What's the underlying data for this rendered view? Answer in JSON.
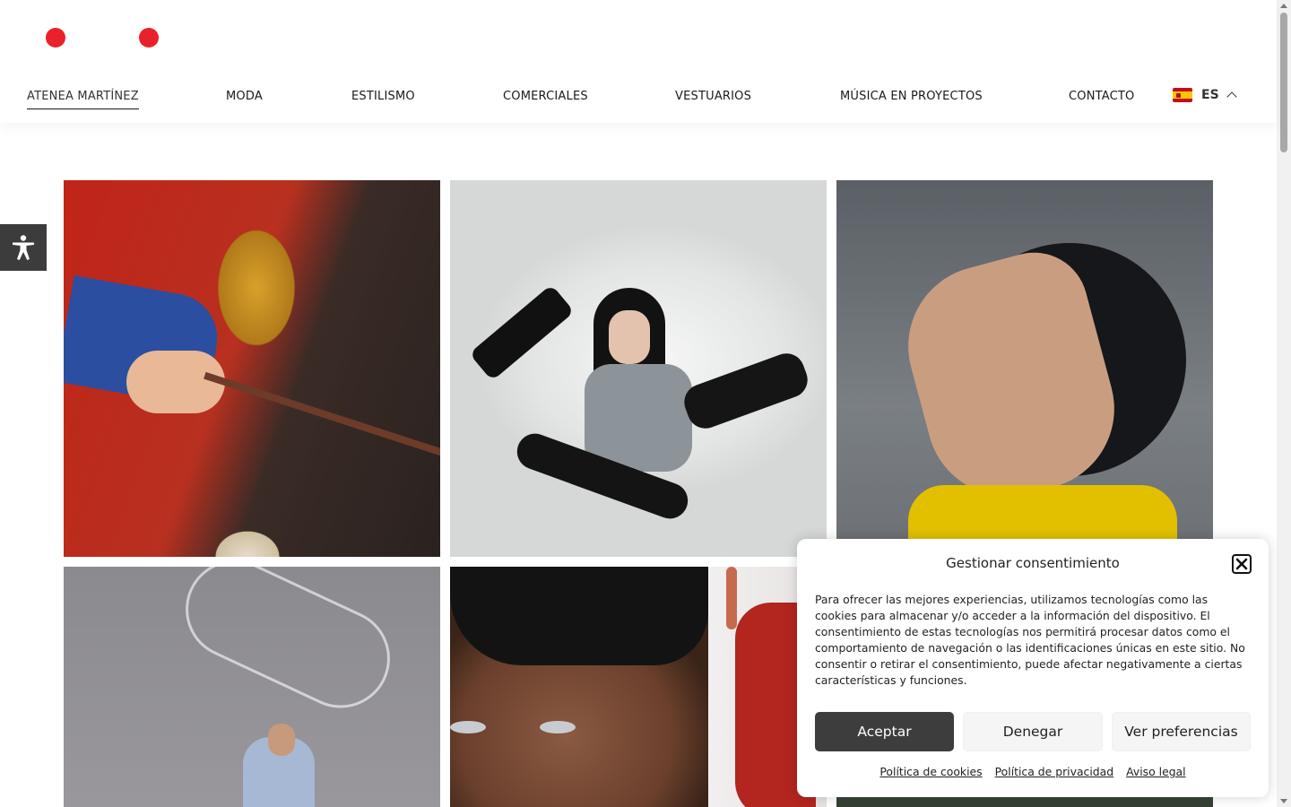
{
  "brand": {
    "accent_color": "#e8222a"
  },
  "nav": {
    "items": [
      {
        "label": "ATENEA MARTÍNEZ"
      },
      {
        "label": "MODA"
      },
      {
        "label": "ESTILISMO"
      },
      {
        "label": "COMERCIALES"
      },
      {
        "label": "VESTUARIOS"
      },
      {
        "label": "MÚSICA EN PROYECTOS"
      },
      {
        "label": "CONTACTO"
      }
    ],
    "active_index": 0,
    "language": {
      "code": "ES",
      "flag_icon": "spain-flag-icon"
    }
  },
  "accessibility": {
    "icon": "accessibility-icon"
  },
  "gallery": {
    "images": [
      {
        "subject": "rider-red-jacket-gold-chain"
      },
      {
        "subject": "woman-black-lace-boots"
      },
      {
        "subject": "man-head-tilted-tongue"
      },
      {
        "subject": "man-bubble-sky"
      },
      {
        "subject": "eyes-closeup-black-hair"
      },
      {
        "subject": "figure-red-outfit"
      },
      {
        "subject": "landscape-partial"
      }
    ]
  },
  "consent": {
    "title": "Gestionar consentimiento",
    "text": "Para ofrecer las mejores experiencias, utilizamos tecnologías como las cookies para almacenar y/o acceder a la información del dispositivo. El consentimiento de estas tecnologías nos permitirá procesar datos como el comportamiento de navegación o las identificaciones únicas en este sitio. No consentir o retirar el consentimiento, puede afectar negativamente a ciertas características y funciones.",
    "accept_label": "Aceptar",
    "deny_label": "Denegar",
    "prefs_label": "Ver preferencias",
    "links": [
      "Política de cookies",
      "Política de privacidad",
      "Aviso legal"
    ]
  }
}
